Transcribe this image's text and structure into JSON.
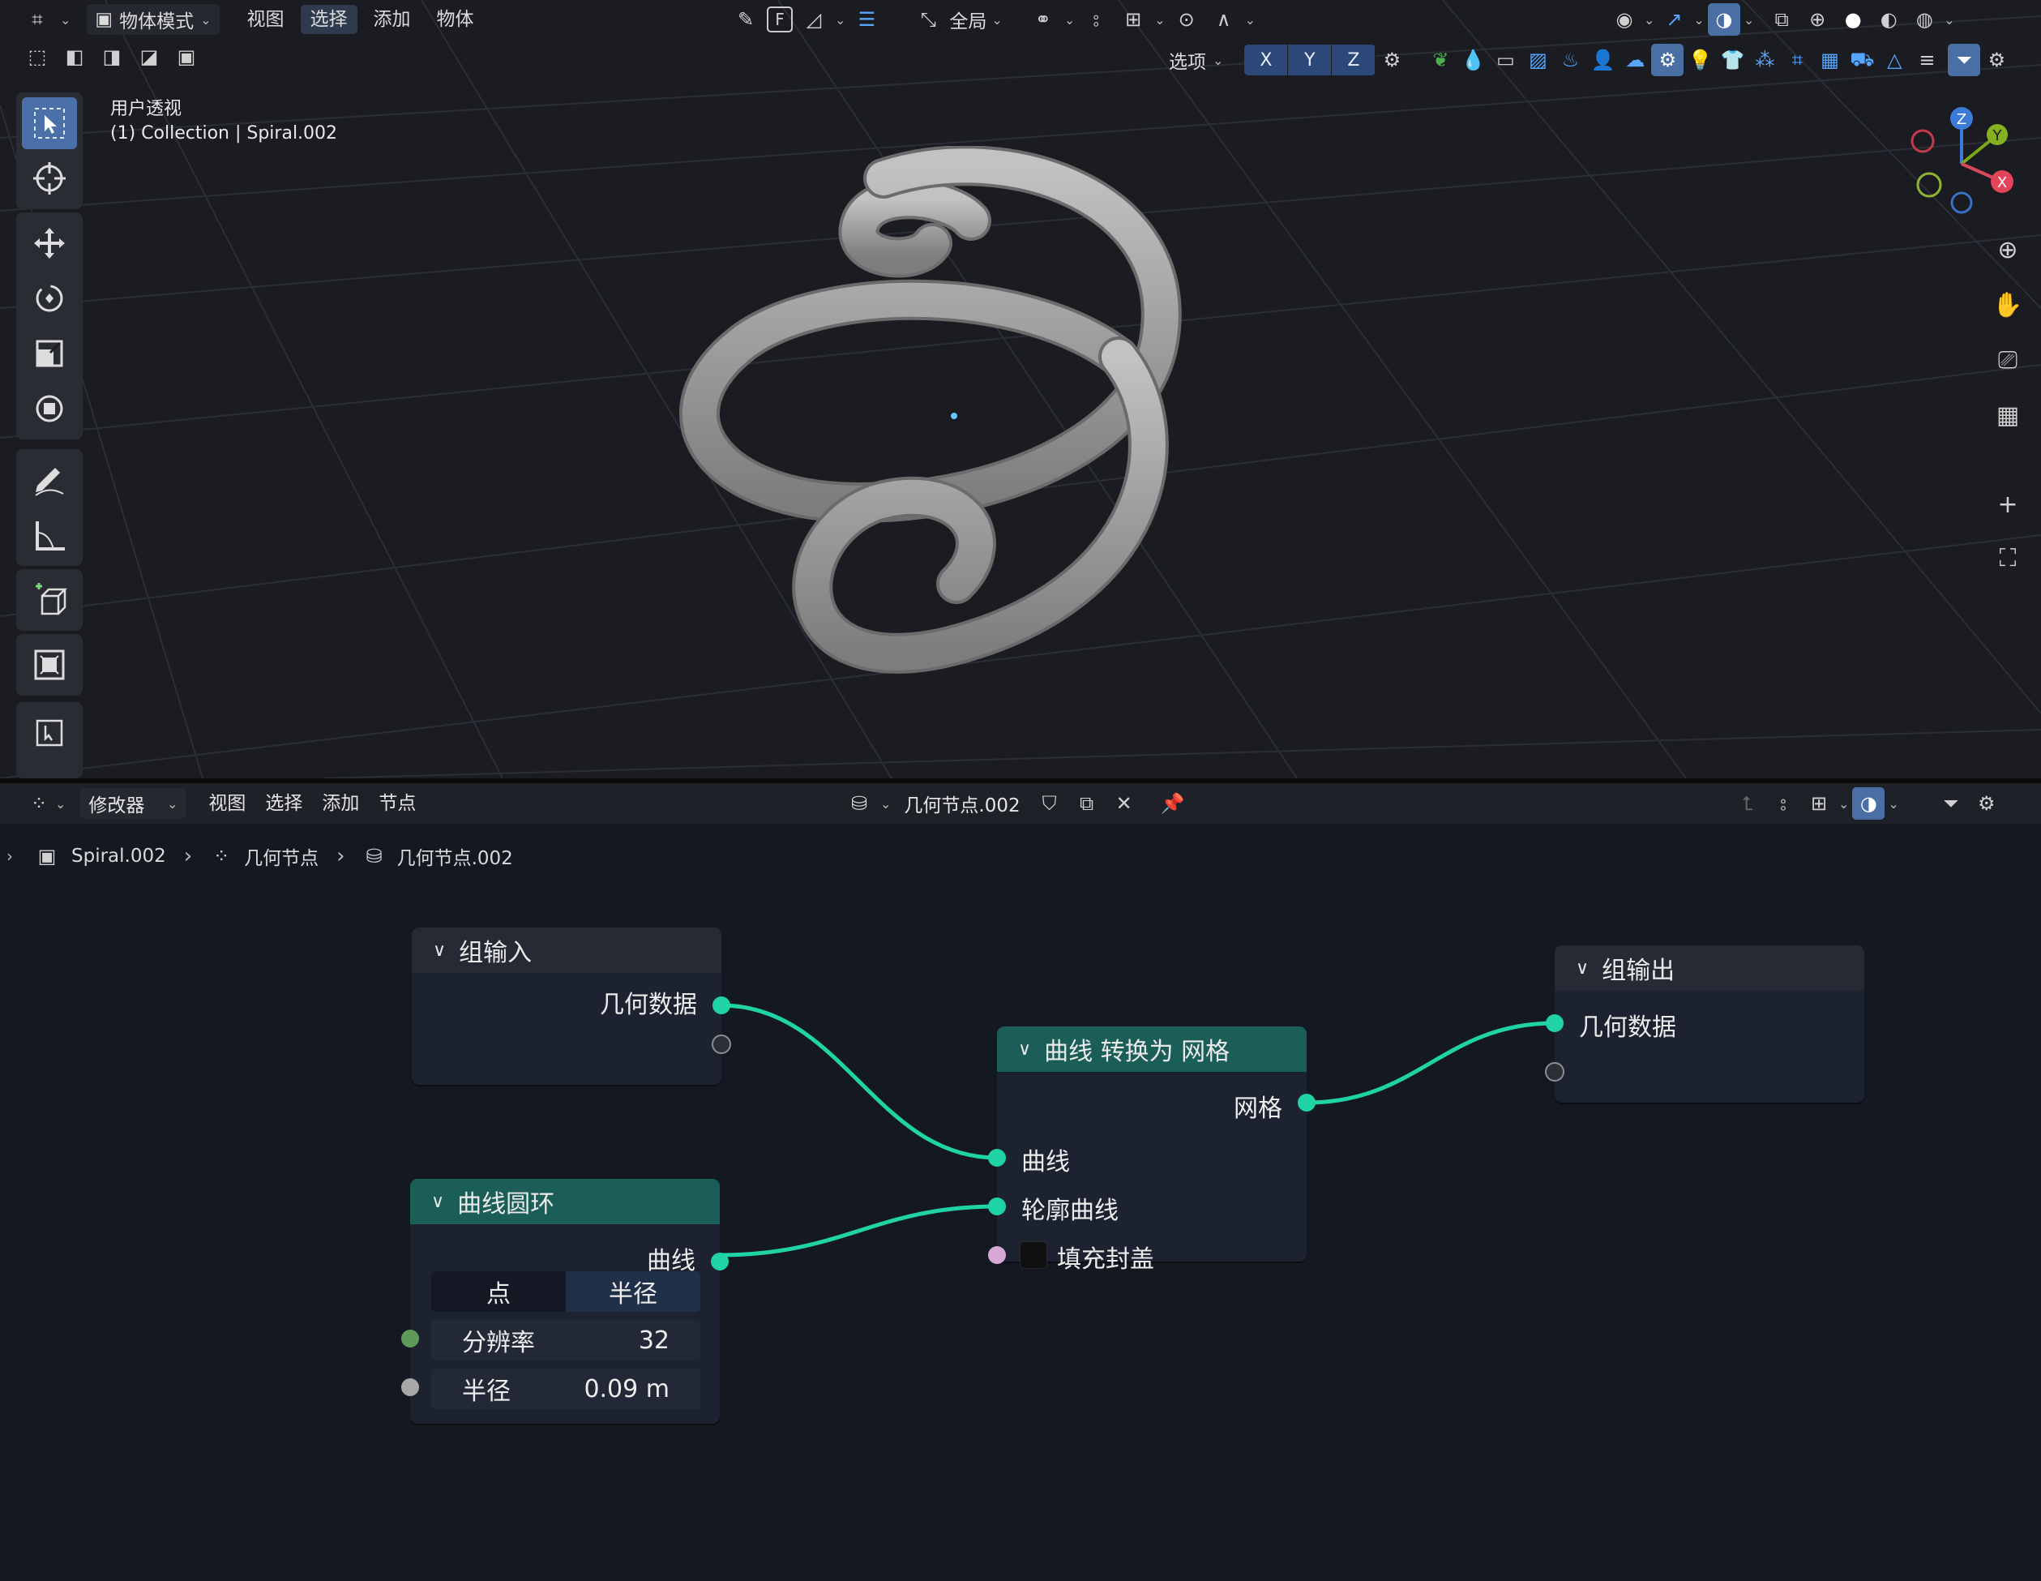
{
  "viewport_header": {
    "mode": "物体模式",
    "menus": [
      "视图",
      "选择",
      "添加",
      "物体"
    ],
    "transform_orientation": "全局",
    "options_label": "选项",
    "axes": [
      "X",
      "Y",
      "Z"
    ],
    "snap_key": "F"
  },
  "viewport": {
    "view_name": "用户透视",
    "object_info": "(1) Collection | Spiral.002"
  },
  "gizmo": {
    "z": "Z",
    "y": "Y",
    "x": "X"
  },
  "node_header": {
    "editor_type": "修改器",
    "menus": [
      "视图",
      "选择",
      "添加",
      "节点"
    ],
    "node_tree_name": "几何节点.002"
  },
  "breadcrumb": {
    "object": "Spiral.002",
    "modifier": "几何节点",
    "tree": "几何节点.002"
  },
  "nodes": {
    "group_input": {
      "title": "组输入",
      "output_geometry": "几何数据"
    },
    "group_output": {
      "title": "组输出",
      "input_geometry": "几何数据"
    },
    "curve_to_mesh": {
      "title": "曲线 转换为 网格",
      "output_mesh": "网格",
      "input_curve": "曲线",
      "input_profile": "轮廓曲线",
      "input_fill_caps": "填充封盖"
    },
    "curve_circle": {
      "title": "曲线圆环",
      "output_curve": "曲线",
      "mode_points": "点",
      "mode_radius": "半径",
      "mode_selected": "半径",
      "resolution_label": "分辨率",
      "resolution_value": "32",
      "radius_label": "半径",
      "radius_value": "0.09 m"
    }
  },
  "colors": {
    "geometry_socket": "#1fd3a5",
    "node_header_geometry": "#1b5e57",
    "active_blue": "#4b6fa8"
  }
}
